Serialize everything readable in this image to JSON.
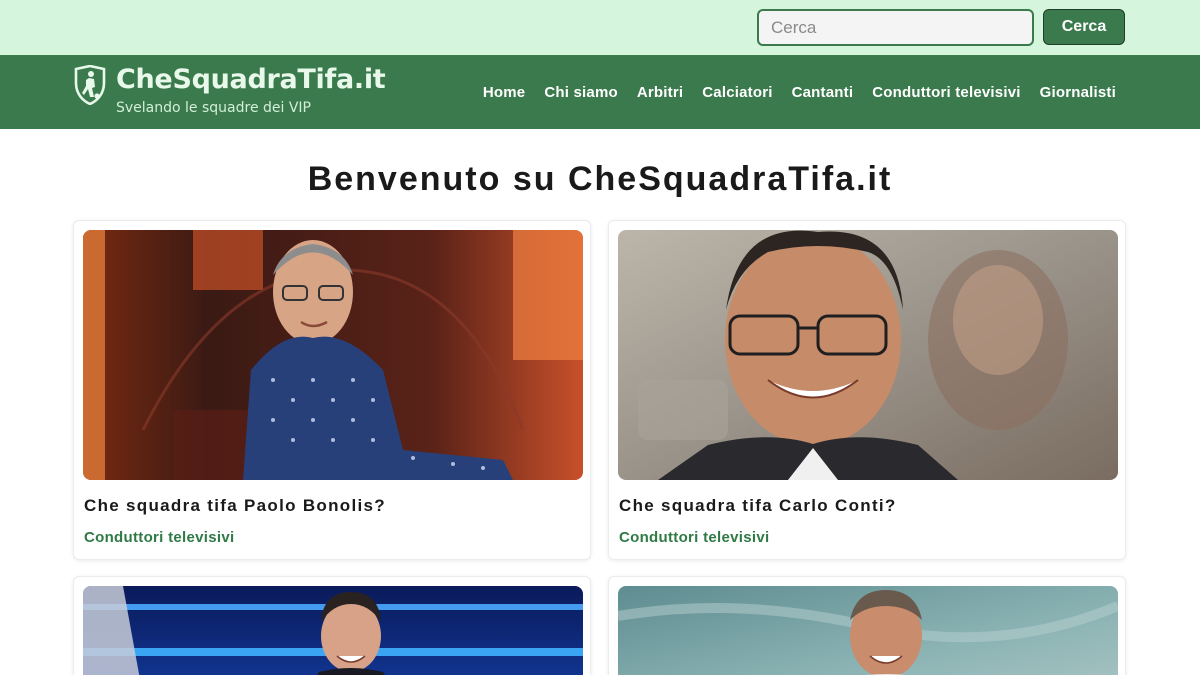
{
  "search": {
    "placeholder": "Cerca",
    "button_label": "Cerca"
  },
  "brand": {
    "title": "CheSquadraTifa.it",
    "tagline": "Svelando le squadre dei VIP",
    "logo_icon": "shield-player-icon"
  },
  "nav": {
    "items": [
      {
        "label": "Home"
      },
      {
        "label": "Chi siamo"
      },
      {
        "label": "Arbitri"
      },
      {
        "label": "Calciatori"
      },
      {
        "label": "Cantanti"
      },
      {
        "label": "Conduttori televisivi"
      },
      {
        "label": "Giornalisti"
      }
    ]
  },
  "main": {
    "heading_prefix": "Benvenuto su",
    "heading_brand": "CheSquadraTifa.it"
  },
  "cards": [
    {
      "title": "Che squadra tifa Paolo Bonolis?",
      "category": "Conduttori televisivi"
    },
    {
      "title": "Che squadra tifa Carlo Conti?",
      "category": "Conduttori televisivi"
    },
    {
      "title": "",
      "category": ""
    },
    {
      "title": "",
      "category": ""
    }
  ],
  "colors": {
    "topbar": "#d5f5dc",
    "nav": "#3a7a4c",
    "accent": "#2f7a45",
    "button": "#3a7a4c"
  }
}
